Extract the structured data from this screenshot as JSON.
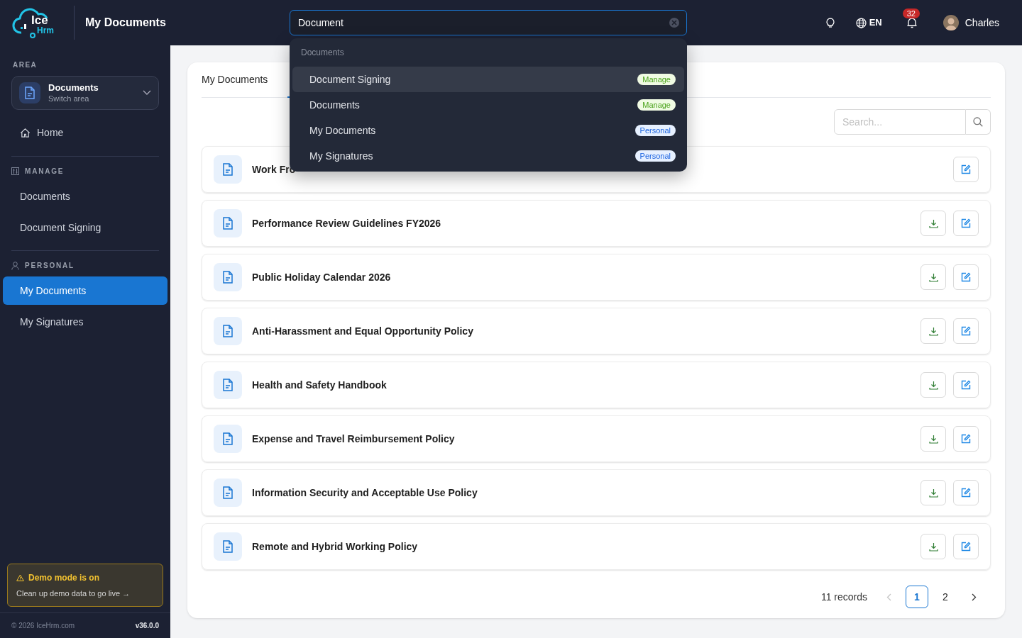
{
  "header": {
    "logo": {
      "primary": "Ice",
      "secondary": "Hrm"
    },
    "title": "My Documents",
    "search": {
      "value": "Document"
    },
    "language": "EN",
    "notifications": "32",
    "user": "Charles"
  },
  "search_results": {
    "group": "Documents",
    "items": [
      {
        "label": "Document Signing",
        "tag": "Manage",
        "kind": "manage",
        "selected": true
      },
      {
        "label": "Documents",
        "tag": "Manage",
        "kind": "manage",
        "selected": false
      },
      {
        "label": "My Documents",
        "tag": "Personal",
        "kind": "personal",
        "selected": false
      },
      {
        "label": "My Signatures",
        "tag": "Personal",
        "kind": "personal",
        "selected": false
      }
    ]
  },
  "sidebar": {
    "area_label": "AREA",
    "area": {
      "title": "Documents",
      "subtitle": "Switch area"
    },
    "home": "Home",
    "sections": [
      {
        "title": "MANAGE",
        "items": [
          {
            "label": "Documents",
            "selected": false
          },
          {
            "label": "Document Signing",
            "selected": false
          }
        ]
      },
      {
        "title": "PERSONAL",
        "items": [
          {
            "label": "My Documents",
            "selected": true
          },
          {
            "label": "My Signatures",
            "selected": false
          }
        ]
      }
    ],
    "demo": {
      "title": "Demo mode is on",
      "text": "Clean up demo data to go live →"
    },
    "footer": {
      "copyright": "© 2026 IceHrm.com",
      "version": "v36.0.0"
    }
  },
  "tabs": [
    {
      "label": "My Documents",
      "selected": false
    },
    {
      "selected": true
    }
  ],
  "list_search": {
    "placeholder": "Search..."
  },
  "documents": [
    {
      "title": "Work Fro",
      "downloadable": false
    },
    {
      "title": "Performance Review Guidelines FY2026",
      "downloadable": true
    },
    {
      "title": "Public Holiday Calendar 2026",
      "downloadable": true
    },
    {
      "title": "Anti-Harassment and Equal Opportunity Policy",
      "downloadable": true
    },
    {
      "title": "Health and Safety Handbook",
      "downloadable": true
    },
    {
      "title": "Expense and Travel Reimbursement Policy",
      "downloadable": true
    },
    {
      "title": "Information Security and Acceptable Use Policy",
      "downloadable": true
    },
    {
      "title": "Remote and Hybrid Working Policy",
      "downloadable": true
    }
  ],
  "pagination": {
    "total": "11 records",
    "pages": [
      {
        "label": "1",
        "selected": true
      },
      {
        "label": "2",
        "selected": false
      }
    ]
  }
}
